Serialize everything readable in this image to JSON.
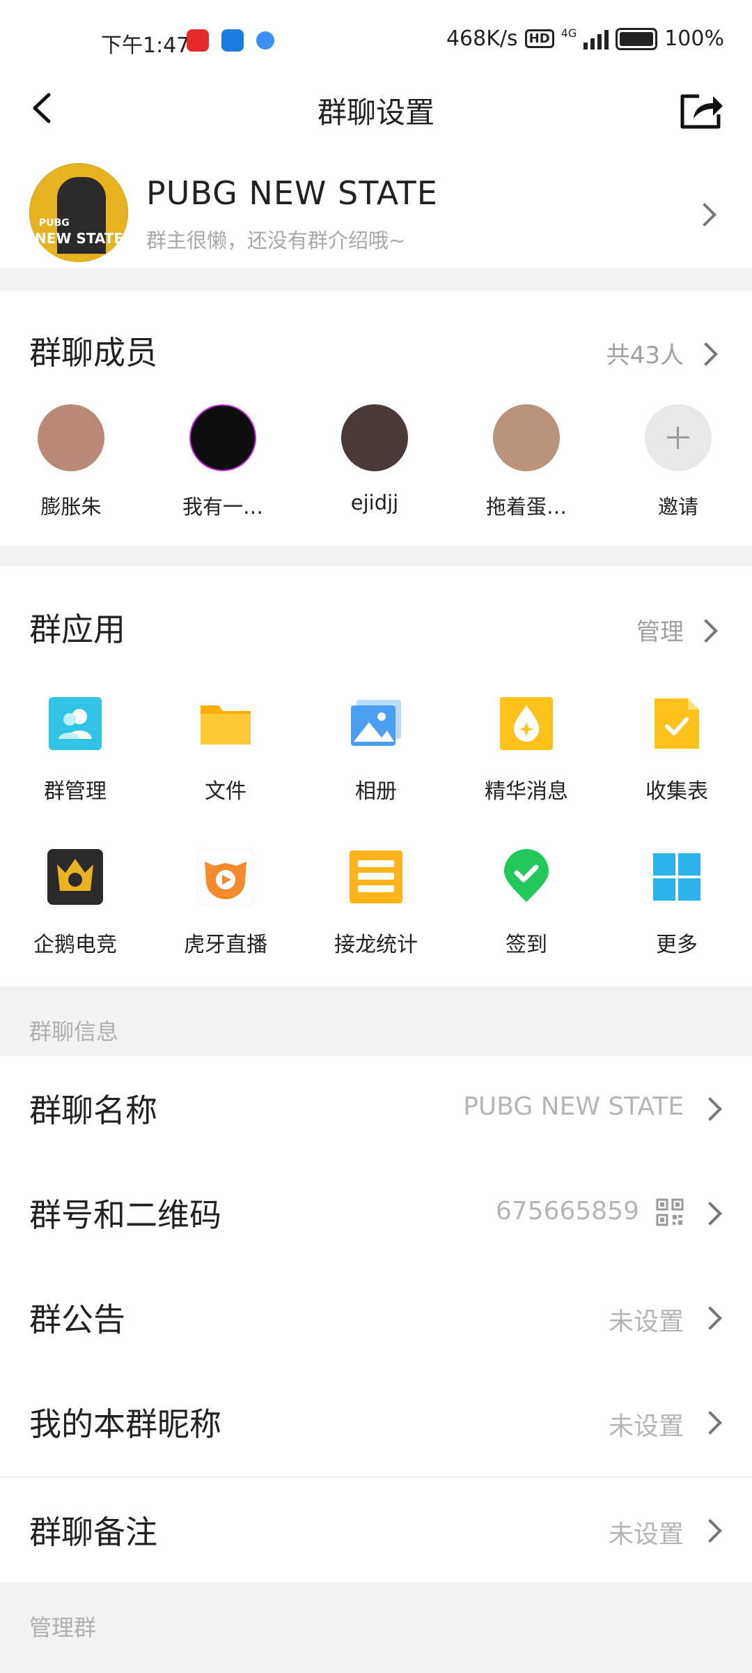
{
  "status_bar": {
    "time": "下午1:47",
    "speed": "468K/s",
    "hd": "HD",
    "network": "4G",
    "battery": "100%"
  },
  "header": {
    "title": "群聊设置",
    "back_icon": "back-arrow-icon",
    "share_icon": "share-icon"
  },
  "group": {
    "name": "PUBG  NEW STATE",
    "description": "群主很懒，还没有群介绍哦~",
    "avatar_text_top": "PUBG",
    "avatar_text_bottom": "NEW STATE"
  },
  "members": {
    "title": "群聊成员",
    "count": "共43人",
    "list": [
      {
        "name": "膨胀朱",
        "color": "#b98a7a"
      },
      {
        "name": "我有一…",
        "color": "#0e0e0e"
      },
      {
        "name": "ejidjj",
        "color": "#4a3a38"
      },
      {
        "name": "拖着蛋…",
        "color": "#b9927a"
      }
    ],
    "invite_label": "邀请"
  },
  "apps": {
    "title": "群应用",
    "manage": "管理",
    "row1": [
      {
        "label": "群管理",
        "icon": "group-manage-icon",
        "color": "#2fc3e6"
      },
      {
        "label": "文件",
        "icon": "folder-icon",
        "color": "#ffc21a"
      },
      {
        "label": "相册",
        "icon": "photo-album-icon",
        "color": "#4a9ff0"
      },
      {
        "label": "精华消息",
        "icon": "essence-icon",
        "color": "#ffc21a"
      },
      {
        "label": "收集表",
        "icon": "collect-form-icon",
        "color": "#ffc21a"
      }
    ],
    "row2": [
      {
        "label": "企鹅电竞",
        "icon": "penguin-esports-icon",
        "color": "#2a2a2a"
      },
      {
        "label": "虎牙直播",
        "icon": "huya-live-icon",
        "color": "#f48a2a"
      },
      {
        "label": "接龙统计",
        "icon": "solitaire-stats-icon",
        "color": "#ffb51a"
      },
      {
        "label": "签到",
        "icon": "checkin-icon",
        "color": "#22c95a"
      },
      {
        "label": "更多",
        "icon": "more-grid-icon",
        "color": "#2ab4ea"
      }
    ]
  },
  "info": {
    "section_label": "群聊信息",
    "rows": [
      {
        "label": "群聊名称",
        "value": "PUBG  NEW STATE"
      },
      {
        "label": "群号和二维码",
        "value": "675665859"
      },
      {
        "label": "群公告",
        "value": "未设置"
      },
      {
        "label": "我的本群昵称",
        "value": "未设置"
      },
      {
        "label": "群聊备注",
        "value": "未设置"
      }
    ]
  },
  "manage_section_label": "管理群"
}
